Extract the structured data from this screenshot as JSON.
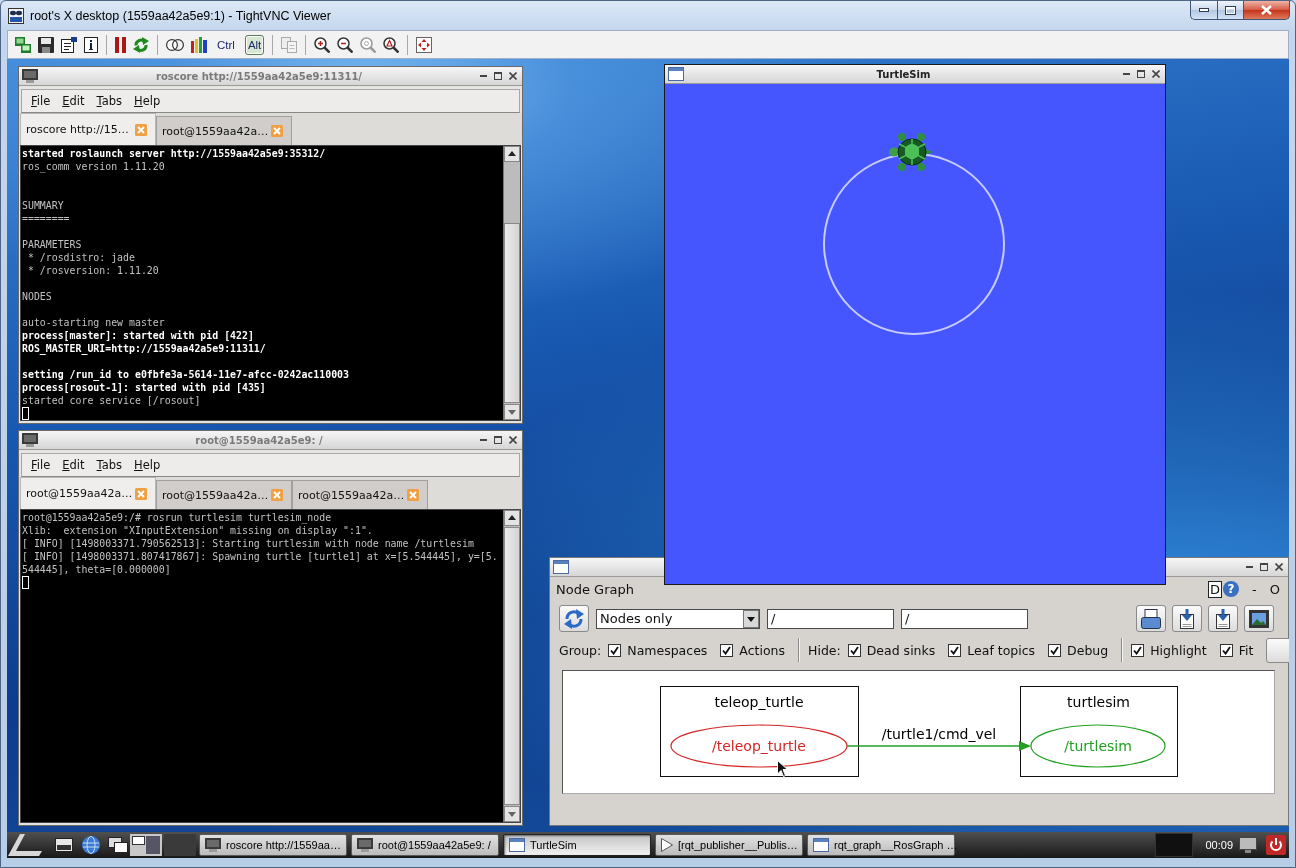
{
  "window": {
    "title": "root's X desktop (1559aa42a5e9:1) - TightVNC Viewer"
  },
  "toolbar": {
    "keys": [
      {
        "label": "Ctrl",
        "pressed": false
      },
      {
        "label": "Alt",
        "pressed": true
      }
    ]
  },
  "terminals": [
    {
      "title": "roscore http://1559aa42a5e9:11311/",
      "menu": [
        "File",
        "Edit",
        "Tabs",
        "Help"
      ],
      "tabs": [
        {
          "label": "roscore http://15…",
          "selected": true
        },
        {
          "label": "root@1559aa42a…",
          "selected": false
        }
      ],
      "lines": [
        {
          "kind": "bold",
          "text": "started roslaunch server http://1559aa42a5e9:35312/"
        },
        {
          "kind": "normal",
          "text": "ros_comm version 1.11.20"
        },
        {
          "kind": "blank"
        },
        {
          "kind": "blank"
        },
        {
          "kind": "normal",
          "text": "SUMMARY"
        },
        {
          "kind": "normal",
          "text": "========"
        },
        {
          "kind": "blank"
        },
        {
          "kind": "normal",
          "text": "PARAMETERS"
        },
        {
          "kind": "normal",
          "text": " * /rosdistro: jade"
        },
        {
          "kind": "normal",
          "text": " * /rosversion: 1.11.20"
        },
        {
          "kind": "blank"
        },
        {
          "kind": "normal",
          "text": "NODES"
        },
        {
          "kind": "blank"
        },
        {
          "kind": "normal",
          "text": "auto-starting new master"
        },
        {
          "kind": "bold",
          "text": "process[master]: started with pid [422]"
        },
        {
          "kind": "bold",
          "text": "ROS_MASTER_URI=http://1559aa42a5e9:11311/"
        },
        {
          "kind": "blank"
        },
        {
          "kind": "bold",
          "text": "setting /run_id to e0fbfe3a-5614-11e7-afcc-0242ac110003"
        },
        {
          "kind": "bold",
          "text": "process[rosout-1]: started with pid [435]"
        },
        {
          "kind": "normal",
          "text": "started core service [/rosout]"
        },
        {
          "kind": "cursor"
        }
      ]
    },
    {
      "title": "root@1559aa42a5e9: /",
      "menu": [
        "File",
        "Edit",
        "Tabs",
        "Help"
      ],
      "tabs": [
        {
          "label": "root@1559aa42a…",
          "selected": true
        },
        {
          "label": "root@1559aa42a…",
          "selected": false
        },
        {
          "label": "root@1559aa42a…",
          "selected": false
        }
      ],
      "lines": [
        {
          "kind": "normal",
          "text": "root@1559aa42a5e9:/# rosrun turtlesim turtlesim_node"
        },
        {
          "kind": "normal",
          "text": "Xlib:  extension \"XInputExtension\" missing on display \":1\"."
        },
        {
          "kind": "normal",
          "text": "[ INFO] [1498003371.790562513]: Starting turtlesim with node name /turtlesim"
        },
        {
          "kind": "normal",
          "text": "[ INFO] [1498003371.807417867]: Spawning turtle [turtle1] at x=[5.544445], y=[5."
        },
        {
          "kind": "normal",
          "text": "544445], theta=[0.000000]"
        },
        {
          "kind": "cursor"
        }
      ]
    }
  ],
  "turtlesim": {
    "title": "TurtleSim"
  },
  "rqt_graph": {
    "panel_title": "Node Graph",
    "title_buttons": [
      {
        "kind": "boxed",
        "label": "D"
      },
      {
        "kind": "round",
        "label": "?"
      },
      {
        "kind": "plain",
        "label": "-"
      },
      {
        "kind": "plain",
        "label": "O"
      }
    ],
    "view_mode": "Nodes only",
    "filters": [
      "/",
      "/"
    ],
    "options": [
      {
        "kind": "label",
        "text": "Group:"
      },
      {
        "kind": "checkbox",
        "label": "Namespaces",
        "checked": true
      },
      {
        "kind": "checkbox",
        "label": "Actions",
        "checked": true
      },
      {
        "kind": "separator"
      },
      {
        "kind": "label",
        "text": "Hide:"
      },
      {
        "kind": "checkbox",
        "label": "Dead sinks",
        "checked": true
      },
      {
        "kind": "checkbox",
        "label": "Leaf topics",
        "checked": true
      },
      {
        "kind": "checkbox",
        "label": "Debug",
        "checked": true
      },
      {
        "kind": "separator"
      },
      {
        "kind": "checkbox",
        "label": "Highlight",
        "checked": true
      },
      {
        "kind": "checkbox",
        "label": "Fit",
        "checked": true
      },
      {
        "kind": "button"
      }
    ],
    "graph": {
      "nodes": [
        {
          "group": "teleop_turtle",
          "name": "/teleop_turtle",
          "color": "#d42626"
        },
        {
          "group": "turtlesim",
          "name": "/turtlesim",
          "color": "#22a022"
        }
      ],
      "edges": [
        {
          "label": "/turtle1/cmd_vel"
        }
      ]
    }
  },
  "taskbar": {
    "tasks": [
      {
        "kind": "terminal",
        "label": "roscore http://1559aa…",
        "selected": false
      },
      {
        "kind": "terminal",
        "label": "root@1559aa42a5e9: /",
        "selected": false
      },
      {
        "kind": "window",
        "label": "TurtleSim",
        "selected": true
      },
      {
        "kind": "player",
        "label": "[rqt_publisher__Publis…",
        "selected": false
      },
      {
        "kind": "window",
        "label": "rqt_graph__RosGraph …",
        "selected": false
      }
    ],
    "clock": "00:09"
  }
}
